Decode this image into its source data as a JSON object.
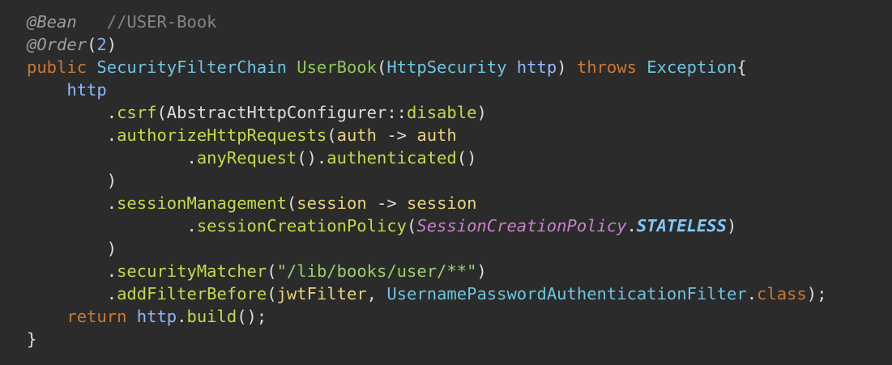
{
  "editor": {
    "lines": [
      [
        [
          "ann",
          "@Bean"
        ],
        [
          "punc",
          "   "
        ],
        [
          "cmt",
          "//USER-Book"
        ]
      ],
      [
        [
          "ann",
          "@Order"
        ],
        [
          "punc",
          "("
        ],
        [
          "num",
          "2"
        ],
        [
          "punc",
          ")"
        ]
      ],
      [
        [
          "kw",
          "public "
        ],
        [
          "type",
          "SecurityFilterChain "
        ],
        [
          "fn",
          "UserBook"
        ],
        [
          "punc",
          "("
        ],
        [
          "type",
          "HttpSecurity "
        ],
        [
          "var",
          "http"
        ],
        [
          "punc",
          ") "
        ],
        [
          "kw",
          "throws "
        ],
        [
          "type",
          "Exception"
        ],
        [
          "punc",
          "{"
        ]
      ],
      [
        [
          "punc",
          "    "
        ],
        [
          "var",
          "http"
        ]
      ],
      [
        [
          "punc",
          "        ."
        ],
        [
          "mth",
          "csrf"
        ],
        [
          "punc",
          "(AbstractHttpConfigurer::"
        ],
        [
          "mth",
          "disable"
        ],
        [
          "punc",
          ")"
        ]
      ],
      [
        [
          "punc",
          "        ."
        ],
        [
          "mth",
          "authorizeHttpRequests"
        ],
        [
          "punc",
          "("
        ],
        [
          "param",
          "auth"
        ],
        [
          "punc",
          " -> "
        ],
        [
          "param",
          "auth"
        ]
      ],
      [
        [
          "punc",
          "                ."
        ],
        [
          "mth",
          "anyRequest"
        ],
        [
          "punc",
          "()."
        ],
        [
          "mth",
          "authenticated"
        ],
        [
          "punc",
          "()"
        ]
      ],
      [
        [
          "punc",
          "        )"
        ]
      ],
      [
        [
          "punc",
          "        ."
        ],
        [
          "mth",
          "sessionManagement"
        ],
        [
          "punc",
          "("
        ],
        [
          "param",
          "session"
        ],
        [
          "punc",
          " -> "
        ],
        [
          "param",
          "session"
        ]
      ],
      [
        [
          "punc",
          "                ."
        ],
        [
          "mth",
          "sessionCreationPolicy"
        ],
        [
          "punc",
          "("
        ],
        [
          "enum",
          "SessionCreationPolicy"
        ],
        [
          "punc",
          "."
        ],
        [
          "const",
          "STATELESS"
        ],
        [
          "punc",
          ")"
        ]
      ],
      [
        [
          "punc",
          "        )"
        ]
      ],
      [
        [
          "punc",
          "        ."
        ],
        [
          "mth",
          "securityMatcher"
        ],
        [
          "punc",
          "("
        ],
        [
          "str",
          "\"/lib/books/user/**\""
        ],
        [
          "punc",
          ")"
        ]
      ],
      [
        [
          "punc",
          "        ."
        ],
        [
          "mth",
          "addFilterBefore"
        ],
        [
          "punc",
          "("
        ],
        [
          "param",
          "jwtFilter"
        ],
        [
          "punc",
          ", "
        ],
        [
          "type",
          "UsernamePasswordAuthenticationFilter"
        ],
        [
          "punc",
          "."
        ],
        [
          "kw",
          "class"
        ],
        [
          "punc",
          ");"
        ]
      ],
      [
        [
          "punc",
          "    "
        ],
        [
          "kw",
          "return "
        ],
        [
          "var",
          "http"
        ],
        [
          "punc",
          "."
        ],
        [
          "mth",
          "build"
        ],
        [
          "punc",
          "();"
        ]
      ],
      [
        [
          "punc",
          "}"
        ]
      ]
    ]
  }
}
